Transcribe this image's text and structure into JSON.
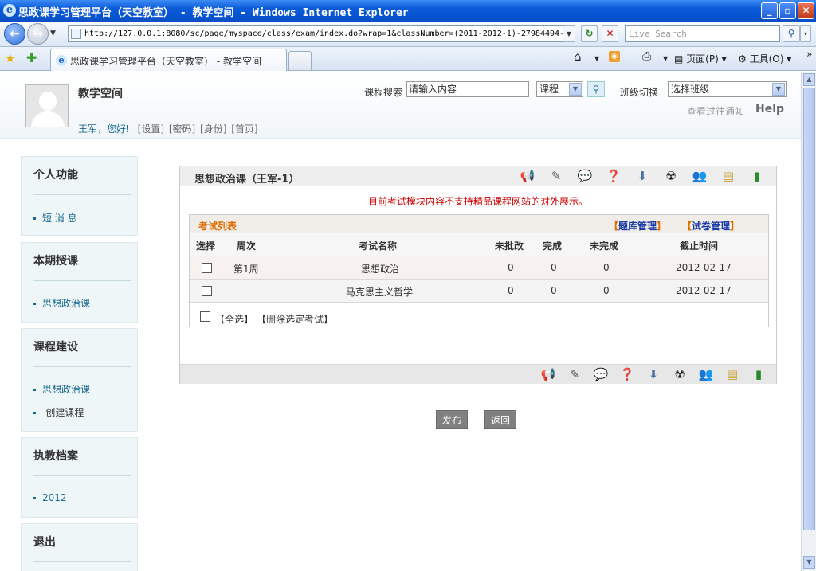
{
  "window": {
    "title": "思政课学习管理平台（天空教室） - 教学空间 - Windows Internet Explorer",
    "ie_logo": "e",
    "buttons": {
      "minimize": "_",
      "maximize": "▫",
      "close": "✕"
    }
  },
  "addressbar": {
    "url": "http://127.0.0.1:8080/sc/page/myspace/class/exam/index.do?wrap=1&classNumber=(2011-2012-1)-27984494-",
    "search_placeholder": "Live Search",
    "back_glyph": "←",
    "forward_glyph": "→",
    "refresh_glyph": "↻",
    "stop_glyph": "✕",
    "go_glyph": "▾"
  },
  "tabs": [
    {
      "label": "思政课学习管理平台（天空教室） - 教学空间"
    }
  ],
  "toolbar": {
    "page_label": "页面(P)",
    "tools_label": "工具(O)",
    "more": "»"
  },
  "header": {
    "space_title": "教学空间",
    "greeting": "王军，您好!",
    "links": [
      "[设置]",
      "[密码]",
      "[身份]",
      "[首页]"
    ],
    "search_label": "课程搜索",
    "search_value": "请输入内容",
    "search_type": "课程",
    "class_switch_label": "班级切换",
    "class_select": "选择班级",
    "notice_link": "查看过往通知",
    "help": "Help"
  },
  "sidebar": [
    {
      "title": "个人功能",
      "items": [
        "短 消 息"
      ]
    },
    {
      "title": "本期授课",
      "items": [
        "思想政治课"
      ]
    },
    {
      "title": "课程建设",
      "items": [
        "思想政治课",
        "-创建课程-"
      ]
    },
    {
      "title": "执教档案",
      "items": [
        "2012"
      ]
    },
    {
      "title": "退出",
      "items": []
    }
  ],
  "panel": {
    "title": "思想政治课（王军-1）",
    "warning": "目前考试模块内容不支持精品课程网站的对外展示。",
    "list_label": "考试列表",
    "bank_manage": "题库管理",
    "paper_manage": "试卷管理",
    "columns": [
      "选择",
      "周次",
      "考试名称",
      "未批改",
      "完成",
      "未完成",
      "截止时间"
    ],
    "rows": [
      {
        "week": "第1周",
        "name": "思想政治",
        "ungraded": "0",
        "done": "0",
        "undone": "0",
        "deadline": "2012-02-17"
      },
      {
        "week": "",
        "name": "马克思主义哲学",
        "ungraded": "0",
        "done": "0",
        "undone": "0",
        "deadline": "2012-02-17"
      }
    ],
    "select_all": "【全选】",
    "delete_selected": "【删除选定考试】",
    "publish": "发布",
    "back": "返回"
  },
  "icons": [
    "megaphone-icon",
    "pen-icon",
    "chat-icon",
    "help-icon",
    "download-icon",
    "radiation-icon",
    "users-icon",
    "notepad-icon",
    "book-icon"
  ]
}
